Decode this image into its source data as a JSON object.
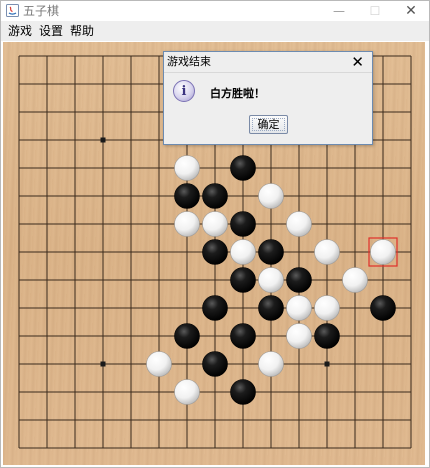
{
  "window": {
    "title": "五子棋",
    "minimize_glyph": "—",
    "maximize_glyph": "☐",
    "close_glyph": "✕"
  },
  "menu": [
    "游戏",
    "设置",
    "帮助"
  ],
  "board": {
    "size": 15,
    "star_points": [
      [
        3,
        3
      ],
      [
        11,
        3
      ],
      [
        3,
        11
      ],
      [
        11,
        11
      ]
    ],
    "black_stones": [
      [
        8,
        4
      ],
      [
        6,
        5
      ],
      [
        7,
        5
      ],
      [
        8,
        6
      ],
      [
        7,
        7
      ],
      [
        9,
        7
      ],
      [
        8,
        8
      ],
      [
        10,
        8
      ],
      [
        7,
        9
      ],
      [
        9,
        9
      ],
      [
        13,
        9
      ],
      [
        6,
        10
      ],
      [
        8,
        10
      ],
      [
        11,
        10
      ],
      [
        7,
        11
      ],
      [
        8,
        12
      ]
    ],
    "white_stones": [
      [
        6,
        4
      ],
      [
        9,
        5
      ],
      [
        6,
        6
      ],
      [
        7,
        6
      ],
      [
        10,
        6
      ],
      [
        8,
        7
      ],
      [
        11,
        7
      ],
      [
        13,
        7
      ],
      [
        9,
        8
      ],
      [
        12,
        8
      ],
      [
        10,
        9
      ],
      [
        11,
        9
      ],
      [
        10,
        10
      ],
      [
        5,
        11
      ],
      [
        9,
        11
      ],
      [
        6,
        12
      ]
    ],
    "last_move": [
      13,
      7
    ],
    "last_move_color": "#e0302a"
  },
  "dialog": {
    "title": "游戏结束",
    "close_glyph": "✕",
    "icon": "i",
    "message": "白方胜啦！",
    "ok_label": "确定"
  }
}
